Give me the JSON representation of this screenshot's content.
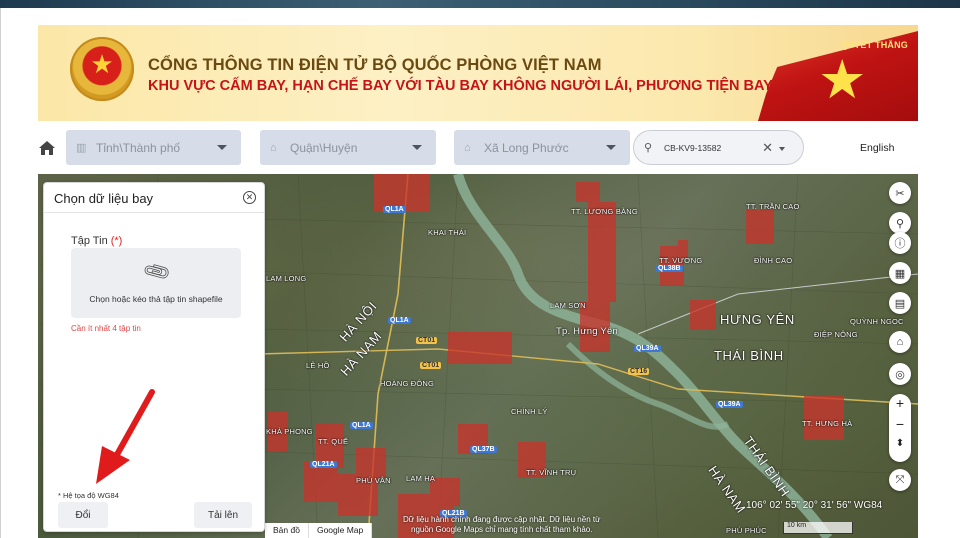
{
  "banner": {
    "title": "CỔNG THÔNG TIN ĐIỆN TỬ BỘ QUỐC PHÒNG VIỆT NAM",
    "subtitle": "KHU VỰC CẤM BAY, HẠN CHẾ BAY VỚI TÀU BAY KHÔNG NGƯỜI LÁI, PHƯƠNG TIỆN BAY KHÁC",
    "motto": "QUYẾT THẮNG"
  },
  "filters": {
    "province": "Tỉnh\\Thành phố",
    "district": "Quận\\Huyện",
    "commune": "Xã Long Phước",
    "search_value": "CB-KV9-13582",
    "language": "English"
  },
  "panel": {
    "title": "Chọn dữ liệu bay",
    "file_label": "Tập Tin",
    "required_mark": "(*)",
    "drop_text": "Chọn hoặc kéo thả tập tin shapefile",
    "hint": "Cần ít nhất 4 tập tin",
    "coord_system": "* Hệ tọa độ WG84",
    "change_button": "Đổi",
    "upload_button": "Tải lên"
  },
  "map": {
    "places": {
      "tt_luong_bang": "TT. LƯƠNG BẰNG",
      "khai_thai": "KHAI THÁI",
      "tt_vuong": "TT. VƯƠNG",
      "dinh_cao": "ĐÌNH CAO",
      "tran_cao": "TT. TRẦN CAO",
      "lam_son": "LAM SƠN",
      "tp_hung_yen": "Tp. Hưng Yên",
      "hung_yen": "HƯNG YÊN",
      "quynh_ngoc": "QUỲNH NGỌC",
      "diep_nong": "ĐIỆP NÔNG",
      "thai_binh": "THÁI BÌNH",
      "ha_noi": "HÀ NỘI",
      "ha_nam": "HÀ NAM",
      "le_ho": "LÊ HỒ",
      "hoang_dong": "HOÀNG ĐÔNG",
      "chinh_ly": "CHÍNH LÝ",
      "tt_que": "TT. QUẾ",
      "kha_phong": "KHẢ PHONG",
      "lam_ha": "LAM HẠ",
      "phu_van": "PHÚ VÂN",
      "tt_vinh_tru": "TT. VĨNH TRỤ",
      "tt_hung_ha": "TT. HƯNG HÀ",
      "thai_binh_2": "THÁI BÌNH",
      "ha_nam_2": "HÀ NAM",
      "phu_phuc": "PHÚ PHÚC",
      "lam_long": "LAM LONG",
      "ql1a_top": "QL1A"
    },
    "roads": {
      "ql1a": "QL1A",
      "ct01": "CT01",
      "ct01b": "CT01",
      "ql38b": "QL38B",
      "ql39a": "QL39A",
      "ql39a_2": "QL39A",
      "ct16": "CT16",
      "ql37b": "QL37B",
      "ql21a": "QL21A",
      "ql21b": "QL21B",
      "ql1a_2": "QL1A"
    },
    "coordinates": "106° 02' 55\" 20° 31' 56\" WG84",
    "scale": "10 km",
    "tabs": [
      "Bản đồ",
      "Google Map"
    ],
    "note_line1": "Dữ liệu hành chính đang được cập nhật. Dữ liệu nền từ",
    "note_line2": "nguồn Google Maps chỉ mang tính chất tham khảo."
  },
  "colors": {
    "restricted_zone": "#c8342c",
    "banner_title": "#6b4a12",
    "banner_subtitle": "#c4141a",
    "select_bg": "#d6dde8",
    "hint_red": "#e04545",
    "arrow_red": "#e01b1b"
  }
}
